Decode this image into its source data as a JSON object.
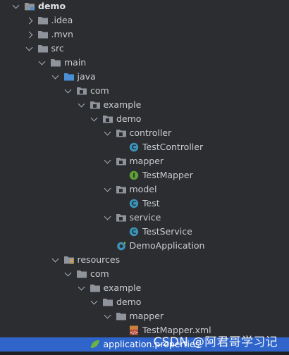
{
  "tree": {
    "items": [
      {
        "label": "demo",
        "indent": 0,
        "expanded": true,
        "icon": "module-folder-icon",
        "bold": true
      },
      {
        "label": ".idea",
        "indent": 1,
        "expanded": false,
        "icon": "folder-icon"
      },
      {
        "label": ".mvn",
        "indent": 1,
        "expanded": false,
        "icon": "folder-icon"
      },
      {
        "label": "src",
        "indent": 1,
        "expanded": true,
        "icon": "folder-icon"
      },
      {
        "label": "main",
        "indent": 2,
        "expanded": true,
        "icon": "folder-icon"
      },
      {
        "label": "java",
        "indent": 3,
        "expanded": true,
        "icon": "source-folder-icon"
      },
      {
        "label": "com",
        "indent": 4,
        "expanded": true,
        "icon": "package-icon"
      },
      {
        "label": "example",
        "indent": 5,
        "expanded": true,
        "icon": "package-icon"
      },
      {
        "label": "demo",
        "indent": 6,
        "expanded": true,
        "icon": "package-icon"
      },
      {
        "label": "controller",
        "indent": 7,
        "expanded": true,
        "icon": "package-icon"
      },
      {
        "label": "TestController",
        "indent": 8,
        "icon": "class-icon"
      },
      {
        "label": "mapper",
        "indent": 7,
        "expanded": true,
        "icon": "package-icon"
      },
      {
        "label": "TestMapper",
        "indent": 8,
        "icon": "interface-icon"
      },
      {
        "label": "model",
        "indent": 7,
        "expanded": true,
        "icon": "package-icon"
      },
      {
        "label": "Test",
        "indent": 8,
        "icon": "class-icon"
      },
      {
        "label": "service",
        "indent": 7,
        "expanded": true,
        "icon": "package-icon"
      },
      {
        "label": "TestService",
        "indent": 8,
        "icon": "class-icon"
      },
      {
        "label": "DemoApplication",
        "indent": 7,
        "icon": "spring-boot-class-icon"
      },
      {
        "label": "resources",
        "indent": 3,
        "expanded": true,
        "icon": "resources-folder-icon"
      },
      {
        "label": "com",
        "indent": 4,
        "expanded": true,
        "icon": "folder-icon"
      },
      {
        "label": "example",
        "indent": 5,
        "expanded": true,
        "icon": "folder-icon"
      },
      {
        "label": "demo",
        "indent": 6,
        "expanded": true,
        "icon": "folder-icon"
      },
      {
        "label": "mapper",
        "indent": 7,
        "expanded": true,
        "icon": "folder-icon"
      },
      {
        "label": "TestMapper.xml",
        "indent": 8,
        "icon": "xml-file-icon"
      },
      {
        "label": "application.properties",
        "indent": 5,
        "icon": "properties-file-icon",
        "selected": true
      }
    ]
  },
  "watermark": "CSDN @阿君哥学习记",
  "colors": {
    "background": "#2b2d30",
    "selection": "#2f65ca",
    "folder": "#8f949c",
    "source_folder": "#4a8fd6",
    "class": "#3c93b8",
    "interface": "#5f9f3a",
    "spring": "#6db33f"
  }
}
